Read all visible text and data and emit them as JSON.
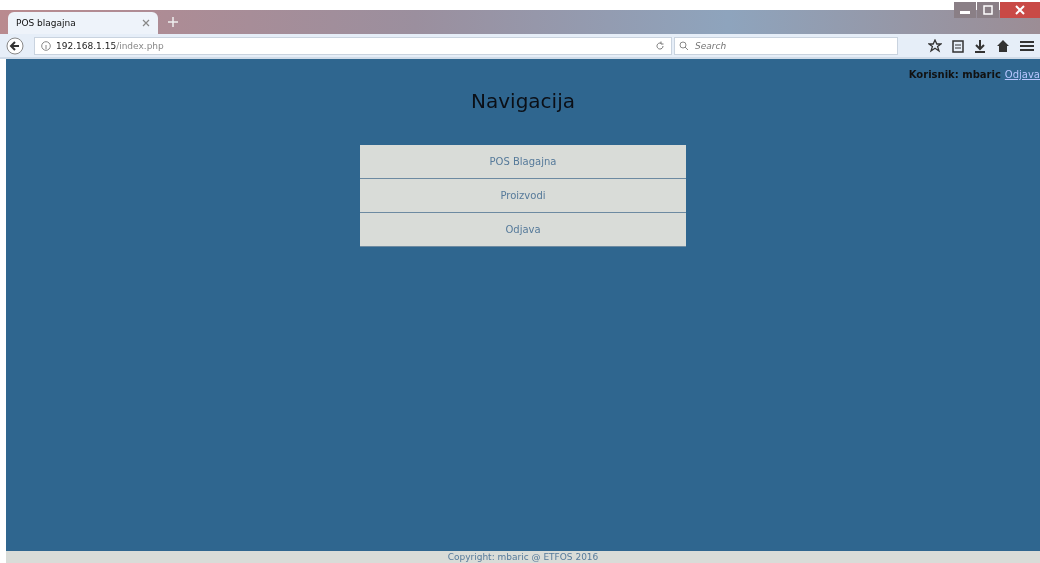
{
  "browser": {
    "tab_title": "POS blagajna",
    "url_host": "192.168.1.15",
    "url_path": "/index.php",
    "search_placeholder": "Search"
  },
  "user": {
    "label": "Korisnik: mbaric",
    "logout": "Odjava"
  },
  "heading": "Navigacija",
  "menu": [
    {
      "label": "POS Blagajna"
    },
    {
      "label": "Proizvodi"
    },
    {
      "label": "Odjava"
    }
  ],
  "footer": "Copyright: mbaric @ ETFOS 2016"
}
